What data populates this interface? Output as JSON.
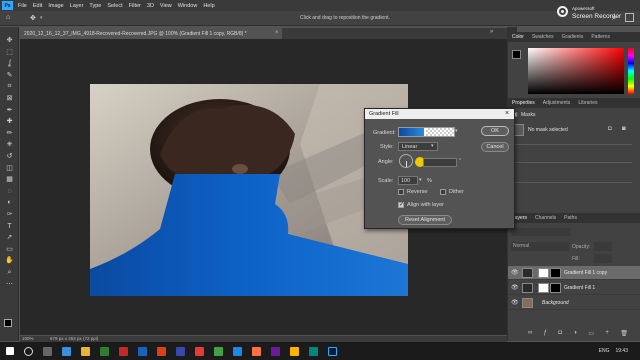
{
  "app": {
    "logo": "Ps"
  },
  "menu": {
    "items": [
      "File",
      "Edit",
      "Image",
      "Layer",
      "Type",
      "Select",
      "Filter",
      "3D",
      "View",
      "Window",
      "Help"
    ]
  },
  "options_bar": {
    "hint": "Click and drag to reposition the gradient."
  },
  "watermark": {
    "brand": "Apowersoft",
    "title": "Screen Recorder"
  },
  "document": {
    "tab_title": "2020_12_16_12_37_IMG_4918-Recovered-Recovered.JPG @ 100% (Gradient Fill 1 copy, RGB/8) *",
    "zoom": "100%",
    "info": "679 px x 452 px (72 ppi)"
  },
  "tools": [
    "move-tool",
    "marquee-tool",
    "lasso-tool",
    "quick-select-tool",
    "crop-tool",
    "frame-tool",
    "eyedropper-tool",
    "healing-tool",
    "brush-tool",
    "stamp-tool",
    "history-brush-tool",
    "eraser-tool",
    "gradient-tool",
    "blur-tool",
    "dodge-tool",
    "pen-tool",
    "type-tool",
    "path-select-tool",
    "shape-tool",
    "hand-tool",
    "zoom-tool",
    "more-tools"
  ],
  "color_panel": {
    "tabs": [
      "Color",
      "Swatches",
      "Gradients",
      "Patterns"
    ],
    "hue": "#ff0000"
  },
  "properties_panel": {
    "tabs": [
      "Properties",
      "Adjustments",
      "Libraries"
    ],
    "section": "Masks",
    "status": "No mask selected"
  },
  "layers_panel": {
    "tabs": [
      "Layers",
      "Channels",
      "Paths"
    ],
    "blend_mode": "Normal",
    "opacity_label": "Opacity:",
    "fill_label": "Fill:",
    "layers": [
      {
        "name": "Gradient Fill 1 copy",
        "selected": true
      },
      {
        "name": "Gradient Fill 1",
        "selected": false
      },
      {
        "name": "Background",
        "selected": false
      }
    ]
  },
  "gradient_dialog": {
    "title": "Gradient Fill",
    "gradient_label": "Gradient:",
    "style_label": "Style:",
    "style_value": "Linear",
    "angle_label": "Angle:",
    "scale_label": "Scale:",
    "scale_value": "100",
    "scale_unit": "%",
    "reverse_label": "Reverse",
    "dither_label": "Dither",
    "align_label": "Align with layer",
    "reset_label": "Reset Alignment",
    "ok_label": "OK",
    "cancel_label": "Cancel",
    "reverse_checked": false,
    "dither_checked": false,
    "align_checked": true
  },
  "taskbar": {
    "language": "ENG",
    "time": "19:43"
  },
  "colors": {
    "accent": "#0d5fb6",
    "gradient_start": "#0b4a9c",
    "gradient_end": "#2b8be0"
  }
}
